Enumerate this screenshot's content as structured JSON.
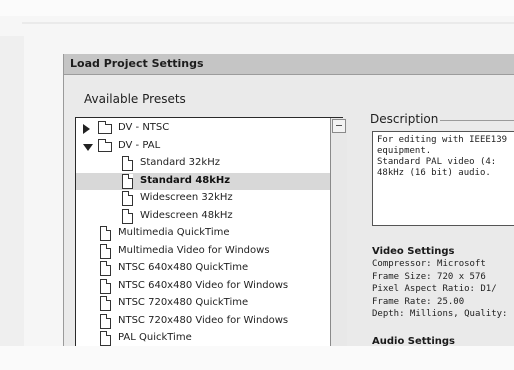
{
  "window": {
    "title": "Load Project Settings",
    "available_presets_label": "Available Presets",
    "description_label": "Description"
  },
  "presets": [
    {
      "label": "DV - NTSC",
      "kind": "folder",
      "state": "collapsed",
      "indent": 0,
      "selected": false
    },
    {
      "label": "DV - PAL",
      "kind": "folder",
      "state": "expanded",
      "indent": 0,
      "selected": false
    },
    {
      "label": "Standard 32kHz",
      "kind": "file",
      "indent": 2,
      "selected": false
    },
    {
      "label": "Standard 48kHz",
      "kind": "file",
      "indent": 2,
      "selected": true
    },
    {
      "label": "Widescreen 32kHz",
      "kind": "file",
      "indent": 2,
      "selected": false
    },
    {
      "label": "Widescreen 48kHz",
      "kind": "file",
      "indent": 2,
      "selected": false
    },
    {
      "label": "Multimedia QuickTime",
      "kind": "file",
      "indent": 1,
      "selected": false
    },
    {
      "label": "Multimedia Video for Windows",
      "kind": "file",
      "indent": 1,
      "selected": false
    },
    {
      "label": "NTSC 640x480 QuickTime",
      "kind": "file",
      "indent": 1,
      "selected": false
    },
    {
      "label": "NTSC 640x480 Video for Windows",
      "kind": "file",
      "indent": 1,
      "selected": false
    },
    {
      "label": "NTSC 720x480 QuickTime",
      "kind": "file",
      "indent": 1,
      "selected": false
    },
    {
      "label": "NTSC 720x480 Video for Windows",
      "kind": "file",
      "indent": 1,
      "selected": false
    },
    {
      "label": "PAL QuickTime",
      "kind": "file",
      "indent": 1,
      "selected": false
    }
  ],
  "description_text": [
    "For editing with IEEE139",
    "equipment.",
    "Standard PAL video (4:",
    "48kHz (16 bit) audio."
  ],
  "video_settings": {
    "heading": "Video Settings",
    "lines": [
      "Compressor: Microsoft",
      "Frame Size: 720 x 576",
      "Pixel Aspect Ratio: D1/",
      "Frame Rate: 25.00",
      "Depth: Millions, Quality:"
    ]
  },
  "audio_settings": {
    "heading": "Audio Settings"
  }
}
